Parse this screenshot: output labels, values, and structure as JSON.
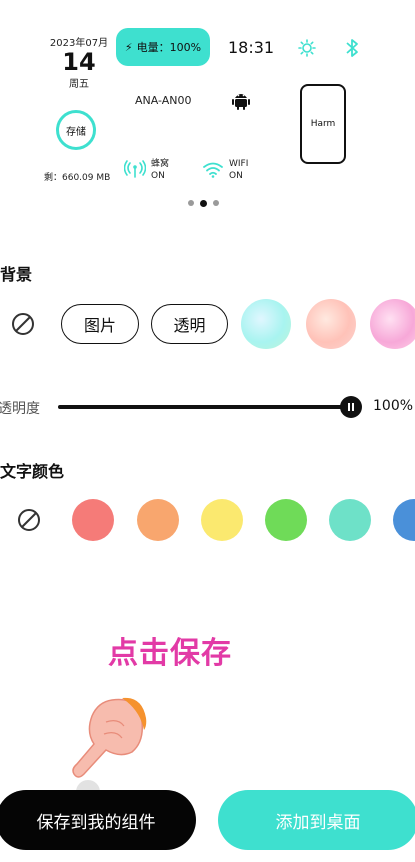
{
  "widget": {
    "date_ym": "2023年07月",
    "day": "14",
    "weekday": "周五",
    "battery": "电量：100%",
    "time": "18:31",
    "model": "ANA-AN00",
    "storage_label": "存储",
    "storage_rest": "剩：660.09 MB",
    "cellular_label": "蜂窝",
    "cellular_state": "ON",
    "wifi_label": "WIFI",
    "wifi_state": "ON",
    "phone_label": "Harm",
    "page_dots": 3,
    "active_dot": 2
  },
  "background": {
    "title": "背景",
    "chips": [
      "图片",
      "透明"
    ],
    "swatch_colors": [
      [
        "#a8f4f0",
        "#e0f6ff",
        "#bff5d8"
      ],
      [
        "#ffc2b8",
        "#ffe9e0",
        "#fbd3cf"
      ],
      [
        "#f7a8d8",
        "#ffe0f2",
        "#ffd0e8"
      ]
    ]
  },
  "opacity": {
    "label": "透明度",
    "value": "100%",
    "level": 1.0
  },
  "text_color": {
    "title": "文字颜色",
    "colors": [
      "#f57b78",
      "#f8a66e",
      "#fbe96f",
      "#6fdb58",
      "#6ee1c8",
      "#4a90d9"
    ]
  },
  "hint": "点击保存",
  "buttons": {
    "save": "保存到我的组件",
    "add": "添加到桌面"
  },
  "accent": "#3ee0cf",
  "hint_color": "#e23aa6"
}
